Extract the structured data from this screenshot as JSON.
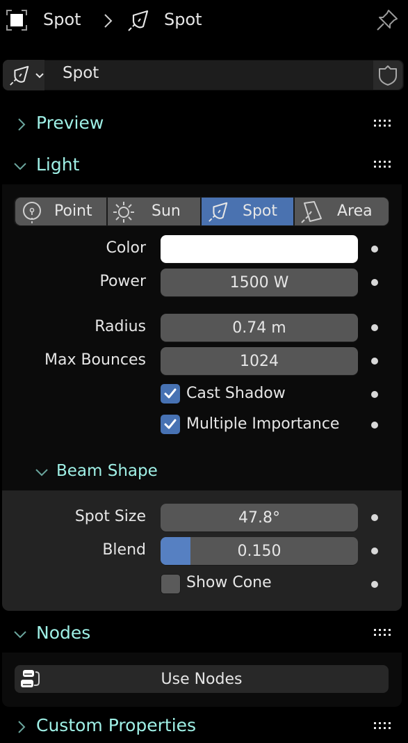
{
  "header": {
    "breadcrumb": [
      {
        "icon": "object-icon",
        "label": "Spot"
      },
      {
        "icon": "spot-light-icon",
        "label": "Spot"
      }
    ],
    "separator": ">",
    "pin_icon": "pin-icon"
  },
  "datablock": {
    "type_icon": "spot-light-icon",
    "name": "Spot",
    "fake_user_icon": "shield-icon"
  },
  "panels": {
    "preview": {
      "label": "Preview",
      "expanded": false
    },
    "light": {
      "label": "Light",
      "expanded": true,
      "types": [
        {
          "label": "Point",
          "icon": "point-light-icon",
          "active": false
        },
        {
          "label": "Sun",
          "icon": "sun-icon",
          "active": false
        },
        {
          "label": "Spot",
          "icon": "spot-light-icon",
          "active": true
        },
        {
          "label": "Area",
          "icon": "area-light-icon",
          "active": false
        }
      ],
      "color": {
        "label": "Color",
        "value": "#ffffff"
      },
      "power": {
        "label": "Power",
        "value": "1500 W"
      },
      "radius": {
        "label": "Radius",
        "value": "0.74 m"
      },
      "max_bounces": {
        "label": "Max Bounces",
        "value": "1024"
      },
      "cast_shadow": {
        "label": "Cast Shadow",
        "checked": true
      },
      "multiple_importance": {
        "label": "Multiple Importance",
        "checked": true
      }
    },
    "beam_shape": {
      "label": "Beam Shape",
      "expanded": true,
      "spot_size": {
        "label": "Spot Size",
        "value": "47.8°"
      },
      "blend": {
        "label": "Blend",
        "value": "0.150",
        "fraction": 0.15
      },
      "show_cone": {
        "label": "Show Cone",
        "checked": false
      }
    },
    "nodes": {
      "label": "Nodes",
      "expanded": true,
      "use_nodes_label": "Use Nodes"
    },
    "custom_properties": {
      "label": "Custom Properties",
      "expanded": false
    }
  },
  "colors": {
    "accent": "#4772b3",
    "panel_header": "#9ff0e6",
    "field": "#565656"
  }
}
